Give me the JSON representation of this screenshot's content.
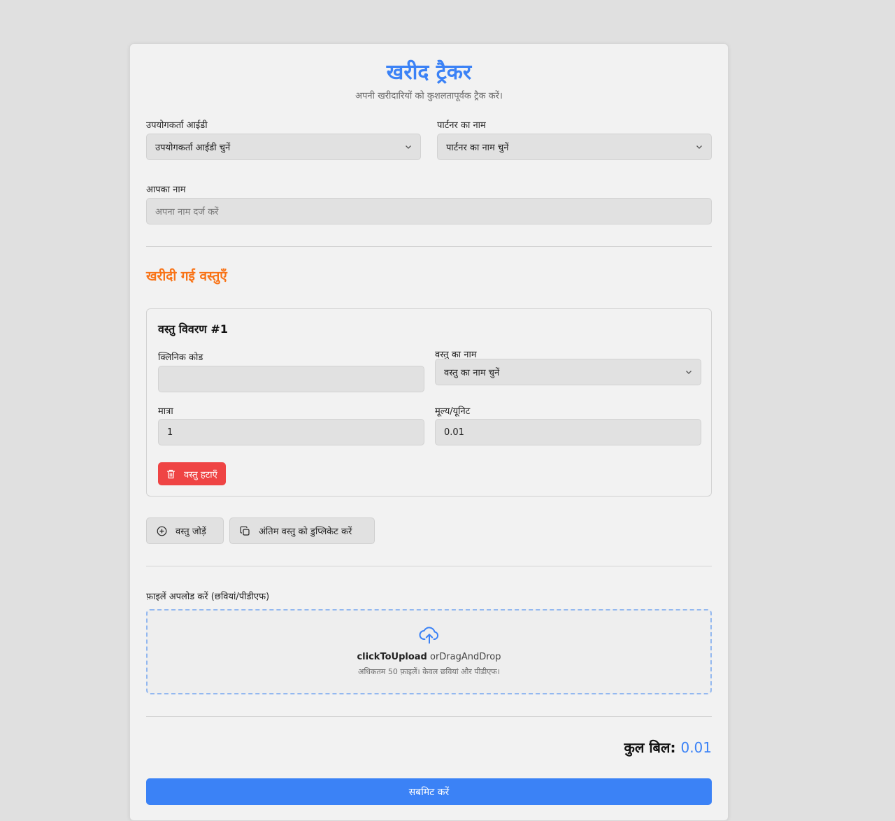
{
  "header": {
    "title": "खरीद ट्रैकर",
    "subtitle": "अपनी खरीदारियों को कुशलतापूर्वक ट्रैक करें।"
  },
  "form": {
    "user_id": {
      "label": "उपयोगकर्ता आईडी",
      "selected": "उपयोगकर्ता आईडी चुनें"
    },
    "partner": {
      "label": "पार्टनर का नाम",
      "selected": "पार्टनर का नाम चुनें"
    },
    "your_name": {
      "label": "आपका नाम",
      "placeholder": "अपना नाम दर्ज करें",
      "value": ""
    }
  },
  "items_section": {
    "title": "खरीदी गई वस्तुएँ",
    "items": [
      {
        "heading": "वस्तु विवरण #1",
        "clinic_code": {
          "label": "क्लिनिक कोड",
          "value": ""
        },
        "item_name": {
          "label": "वस्तु का नाम",
          "selected": "वस्तु का नाम चुनें"
        },
        "quantity": {
          "label": "मात्रा",
          "value": "1"
        },
        "price_per_unit": {
          "label": "मूल्य/यूनिट",
          "value": "0.01"
        },
        "remove_label": "वस्तु हटाएँ"
      }
    ],
    "add_label": "वस्तु जोड़ें",
    "duplicate_label": "अंतिम वस्तु को डुप्लिकेट करें"
  },
  "upload": {
    "label": "फ़ाइलें अपलोड करें (छवियां/पीडीएफ)",
    "click_text": "clickToUpload",
    "drag_text": "orDragAndDrop",
    "hint": "अधिकतम 50 फ़ाइलें। केवल छवियां और पीडीएफ।",
    "icon": "cloud-upload-icon"
  },
  "total": {
    "label": "कुल बिल:",
    "value": "0.01"
  },
  "submit_label": "सबमिट करें",
  "colors": {
    "accent": "#3b82f6",
    "section_title": "#f97316",
    "danger": "#ef4444",
    "page_bg": "#e0e0e0",
    "card_bg": "#f2f2f2"
  }
}
